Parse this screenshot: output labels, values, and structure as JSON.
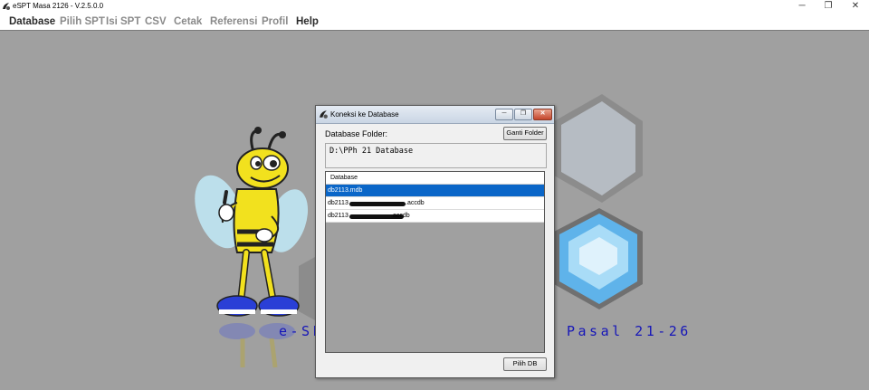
{
  "window": {
    "title": "eSPT Masa 2126 - V.2.5.0.0",
    "minimize_glyph": "─",
    "maximize_glyph": "❐",
    "close_glyph": "✕",
    "icon": "espt-app-icon"
  },
  "menu": [
    {
      "label": "Database",
      "active": true
    },
    {
      "label": "Pilih SPT",
      "active": false
    },
    {
      "label": "Isi SPT",
      "active": false
    },
    {
      "label": "CSV",
      "active": false
    },
    {
      "label": "Cetak",
      "active": false
    },
    {
      "label": "Referensi",
      "active": false
    },
    {
      "label": "Profil",
      "active": false
    },
    {
      "label": "Help",
      "active": true
    }
  ],
  "splash": {
    "left_text": "e-SP",
    "right_text": "Pasal 21-26",
    "text_color": "#1616b8",
    "mascot": "bee-mascot"
  },
  "dialog": {
    "title": "Koneksi ke Database",
    "folder_label": "Database Folder:",
    "change_folder_button": "Ganti Folder",
    "folder_path": "D:\\PPh 21 Database",
    "list_header": "Database",
    "rows": [
      {
        "text": "db2113.mdb",
        "selected": true
      },
      {
        "text": "db2113",
        "suffix": ".accdb",
        "redacted": true,
        "selected": false
      },
      {
        "text": "db2113",
        "suffix": ".accdb",
        "redacted": true,
        "selected": false
      }
    ],
    "select_button": "Pilih DB",
    "selected_color": "#0a66c8"
  }
}
